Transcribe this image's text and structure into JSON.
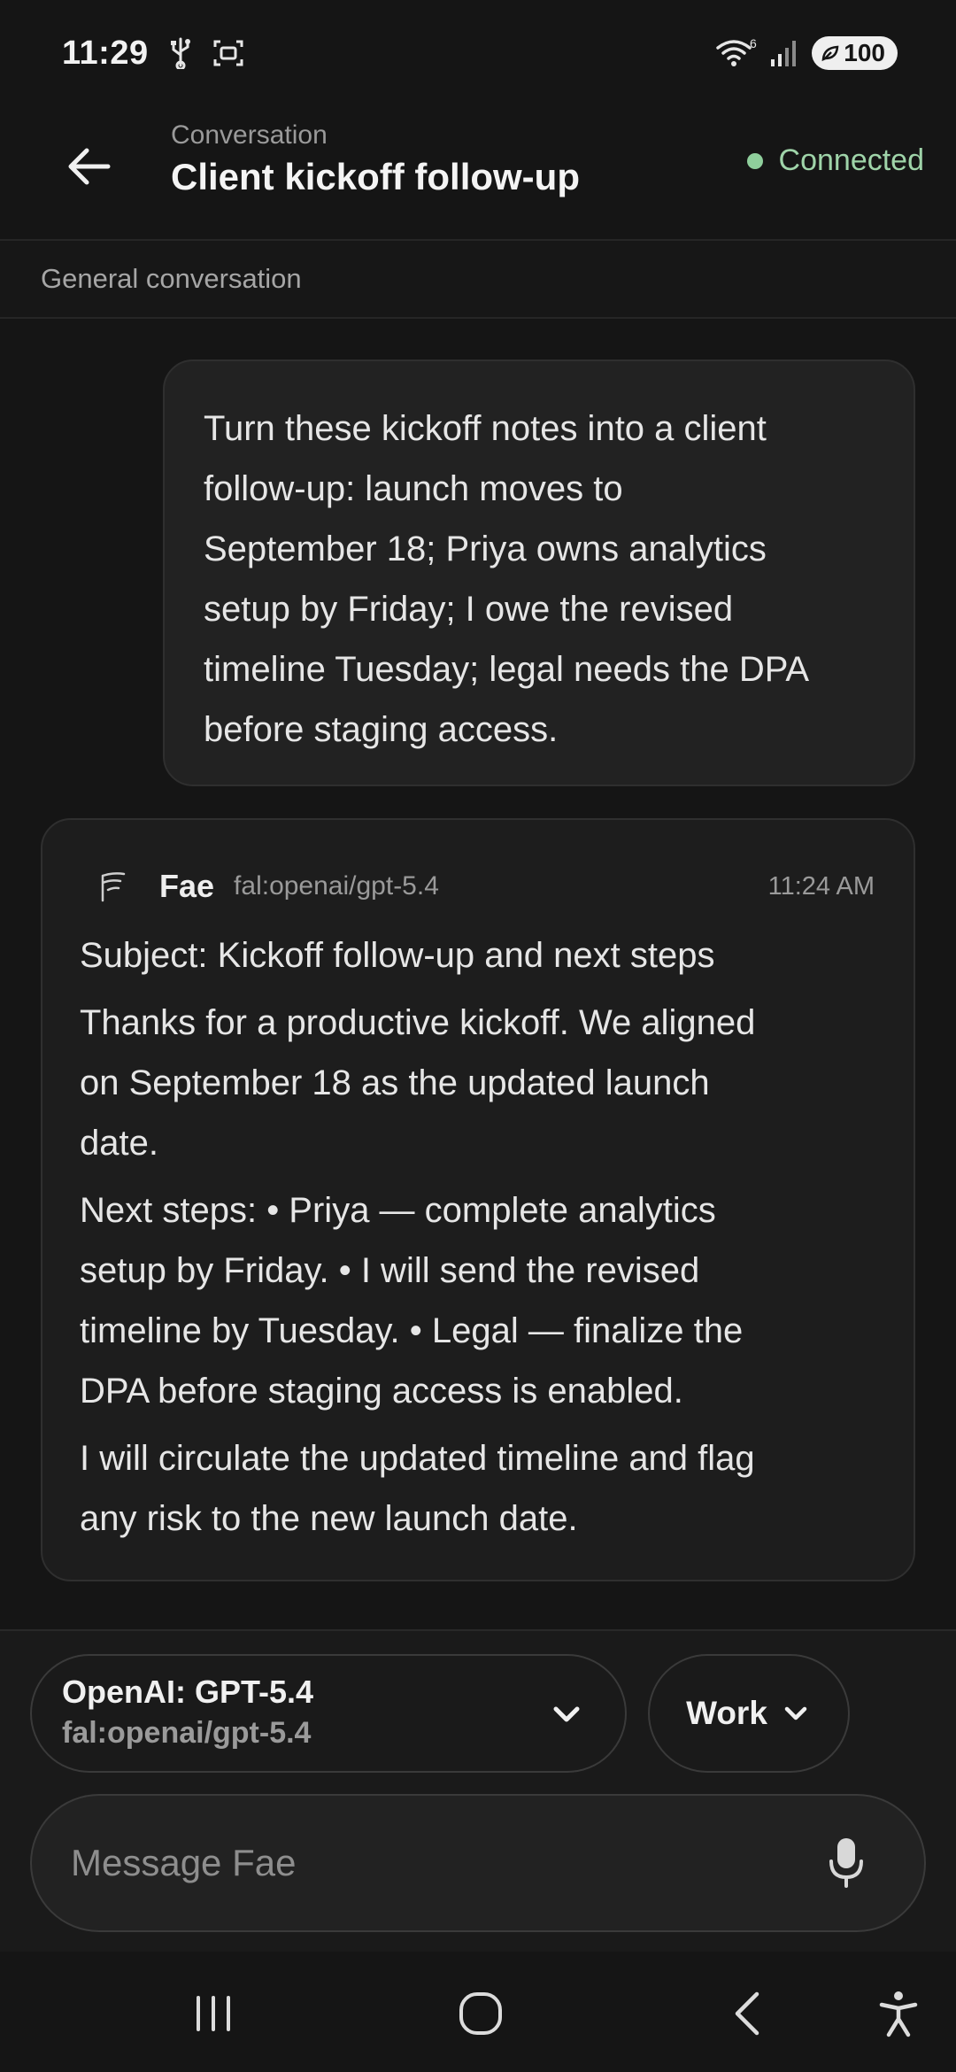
{
  "status_bar": {
    "time": "11:29",
    "battery": "100",
    "network_badge": "6"
  },
  "header": {
    "eyebrow": "Conversation",
    "title": "Client kickoff follow-up",
    "connection": "Connected"
  },
  "section": {
    "label": "General conversation"
  },
  "user_message": {
    "lines": [
      "Turn these kickoff notes into a client",
      "follow-up: launch moves to",
      "September 18; Priya owns analytics",
      "setup by Friday; I owe the revised",
      "timeline Tuesday; legal needs the DPA",
      "before staging access."
    ]
  },
  "assistant_message": {
    "name": "Fae",
    "model": "fal:openai/gpt-5.4",
    "time": "11:24 AM",
    "subject": "Subject: Kickoff follow-up and next steps",
    "para1_lines": [
      "Thanks for a productive kickoff. We aligned",
      "on September 18 as the updated launch",
      "date."
    ],
    "para2_lines": [
      "Next steps: • Priya — complete analytics",
      "setup by Friday. • I will send the revised",
      "timeline by Tuesday. • Legal — finalize the",
      "DPA before staging access is enabled."
    ],
    "para3_lines": [
      "I will circulate the updated timeline and flag",
      "any risk to the new launch date."
    ]
  },
  "composer": {
    "model_name": "OpenAI: GPT-5.4",
    "model_id": "fal:openai/gpt-5.4",
    "mode": "Work",
    "placeholder": "Message Fae"
  },
  "icons": {
    "back": "arrow-left-icon",
    "mic": "microphone-icon",
    "chevron": "chevron-down-icon",
    "nav": [
      "recent-apps-icon",
      "home-icon",
      "back-icon",
      "accessibility-icon"
    ]
  },
  "colors": {
    "background": "#151515",
    "connected": "#9fd4a9",
    "bubble": "#222222"
  }
}
